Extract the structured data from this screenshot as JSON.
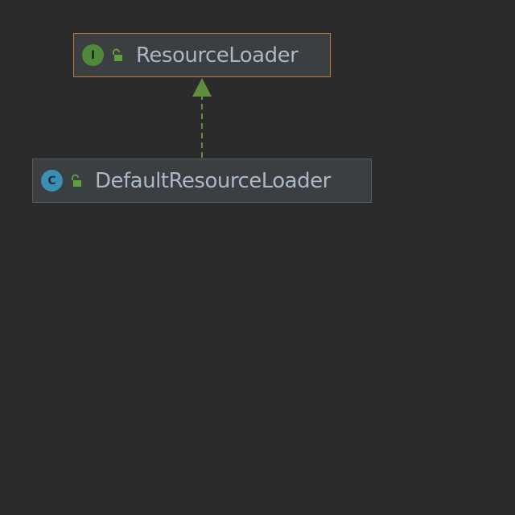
{
  "diagram": {
    "nodes": [
      {
        "kind": "interface",
        "badge_letter": "I",
        "badge_color": "#4e8a3a",
        "icons": [
          "interface-icon",
          "unlocked-lock-icon"
        ],
        "label": "ResourceLoader"
      },
      {
        "kind": "class",
        "badge_letter": "C",
        "badge_color": "#3b8eb4",
        "icons": [
          "class-icon",
          "unlocked-lock-icon"
        ],
        "label": "DefaultResourceLoader"
      }
    ],
    "edges": [
      {
        "from": "DefaultResourceLoader",
        "to": "ResourceLoader",
        "relation": "implements",
        "line_style": "dashed",
        "color": "#5f8f3e"
      }
    ]
  },
  "colors": {
    "background": "#2b2b2b",
    "node_fill": "#3c3f41",
    "selected_border": "#c07a3a",
    "text": "#a9b7c6"
  }
}
